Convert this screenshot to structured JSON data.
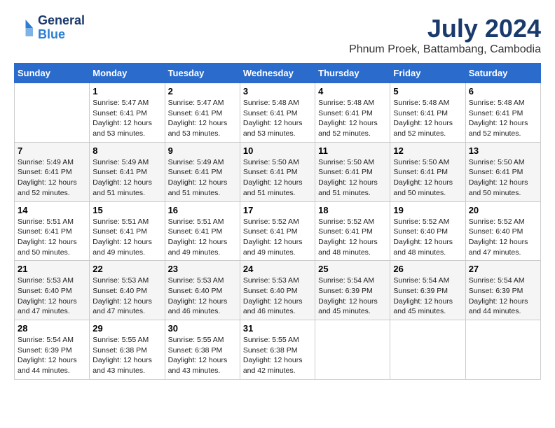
{
  "header": {
    "logo_line1": "General",
    "logo_line2": "Blue",
    "month": "July 2024",
    "location": "Phnum Proek, Battambang, Cambodia"
  },
  "days_of_week": [
    "Sunday",
    "Monday",
    "Tuesday",
    "Wednesday",
    "Thursday",
    "Friday",
    "Saturday"
  ],
  "weeks": [
    [
      {
        "day": "",
        "info": ""
      },
      {
        "day": "1",
        "info": "Sunrise: 5:47 AM\nSunset: 6:41 PM\nDaylight: 12 hours\nand 53 minutes."
      },
      {
        "day": "2",
        "info": "Sunrise: 5:47 AM\nSunset: 6:41 PM\nDaylight: 12 hours\nand 53 minutes."
      },
      {
        "day": "3",
        "info": "Sunrise: 5:48 AM\nSunset: 6:41 PM\nDaylight: 12 hours\nand 53 minutes."
      },
      {
        "day": "4",
        "info": "Sunrise: 5:48 AM\nSunset: 6:41 PM\nDaylight: 12 hours\nand 52 minutes."
      },
      {
        "day": "5",
        "info": "Sunrise: 5:48 AM\nSunset: 6:41 PM\nDaylight: 12 hours\nand 52 minutes."
      },
      {
        "day": "6",
        "info": "Sunrise: 5:48 AM\nSunset: 6:41 PM\nDaylight: 12 hours\nand 52 minutes."
      }
    ],
    [
      {
        "day": "7",
        "info": "Sunrise: 5:49 AM\nSunset: 6:41 PM\nDaylight: 12 hours\nand 52 minutes."
      },
      {
        "day": "8",
        "info": "Sunrise: 5:49 AM\nSunset: 6:41 PM\nDaylight: 12 hours\nand 51 minutes."
      },
      {
        "day": "9",
        "info": "Sunrise: 5:49 AM\nSunset: 6:41 PM\nDaylight: 12 hours\nand 51 minutes."
      },
      {
        "day": "10",
        "info": "Sunrise: 5:50 AM\nSunset: 6:41 PM\nDaylight: 12 hours\nand 51 minutes."
      },
      {
        "day": "11",
        "info": "Sunrise: 5:50 AM\nSunset: 6:41 PM\nDaylight: 12 hours\nand 51 minutes."
      },
      {
        "day": "12",
        "info": "Sunrise: 5:50 AM\nSunset: 6:41 PM\nDaylight: 12 hours\nand 50 minutes."
      },
      {
        "day": "13",
        "info": "Sunrise: 5:50 AM\nSunset: 6:41 PM\nDaylight: 12 hours\nand 50 minutes."
      }
    ],
    [
      {
        "day": "14",
        "info": "Sunrise: 5:51 AM\nSunset: 6:41 PM\nDaylight: 12 hours\nand 50 minutes."
      },
      {
        "day": "15",
        "info": "Sunrise: 5:51 AM\nSunset: 6:41 PM\nDaylight: 12 hours\nand 49 minutes."
      },
      {
        "day": "16",
        "info": "Sunrise: 5:51 AM\nSunset: 6:41 PM\nDaylight: 12 hours\nand 49 minutes."
      },
      {
        "day": "17",
        "info": "Sunrise: 5:52 AM\nSunset: 6:41 PM\nDaylight: 12 hours\nand 49 minutes."
      },
      {
        "day": "18",
        "info": "Sunrise: 5:52 AM\nSunset: 6:41 PM\nDaylight: 12 hours\nand 48 minutes."
      },
      {
        "day": "19",
        "info": "Sunrise: 5:52 AM\nSunset: 6:40 PM\nDaylight: 12 hours\nand 48 minutes."
      },
      {
        "day": "20",
        "info": "Sunrise: 5:52 AM\nSunset: 6:40 PM\nDaylight: 12 hours\nand 47 minutes."
      }
    ],
    [
      {
        "day": "21",
        "info": "Sunrise: 5:53 AM\nSunset: 6:40 PM\nDaylight: 12 hours\nand 47 minutes."
      },
      {
        "day": "22",
        "info": "Sunrise: 5:53 AM\nSunset: 6:40 PM\nDaylight: 12 hours\nand 47 minutes."
      },
      {
        "day": "23",
        "info": "Sunrise: 5:53 AM\nSunset: 6:40 PM\nDaylight: 12 hours\nand 46 minutes."
      },
      {
        "day": "24",
        "info": "Sunrise: 5:53 AM\nSunset: 6:40 PM\nDaylight: 12 hours\nand 46 minutes."
      },
      {
        "day": "25",
        "info": "Sunrise: 5:54 AM\nSunset: 6:39 PM\nDaylight: 12 hours\nand 45 minutes."
      },
      {
        "day": "26",
        "info": "Sunrise: 5:54 AM\nSunset: 6:39 PM\nDaylight: 12 hours\nand 45 minutes."
      },
      {
        "day": "27",
        "info": "Sunrise: 5:54 AM\nSunset: 6:39 PM\nDaylight: 12 hours\nand 44 minutes."
      }
    ],
    [
      {
        "day": "28",
        "info": "Sunrise: 5:54 AM\nSunset: 6:39 PM\nDaylight: 12 hours\nand 44 minutes."
      },
      {
        "day": "29",
        "info": "Sunrise: 5:55 AM\nSunset: 6:38 PM\nDaylight: 12 hours\nand 43 minutes."
      },
      {
        "day": "30",
        "info": "Sunrise: 5:55 AM\nSunset: 6:38 PM\nDaylight: 12 hours\nand 43 minutes."
      },
      {
        "day": "31",
        "info": "Sunrise: 5:55 AM\nSunset: 6:38 PM\nDaylight: 12 hours\nand 42 minutes."
      },
      {
        "day": "",
        "info": ""
      },
      {
        "day": "",
        "info": ""
      },
      {
        "day": "",
        "info": ""
      }
    ]
  ]
}
